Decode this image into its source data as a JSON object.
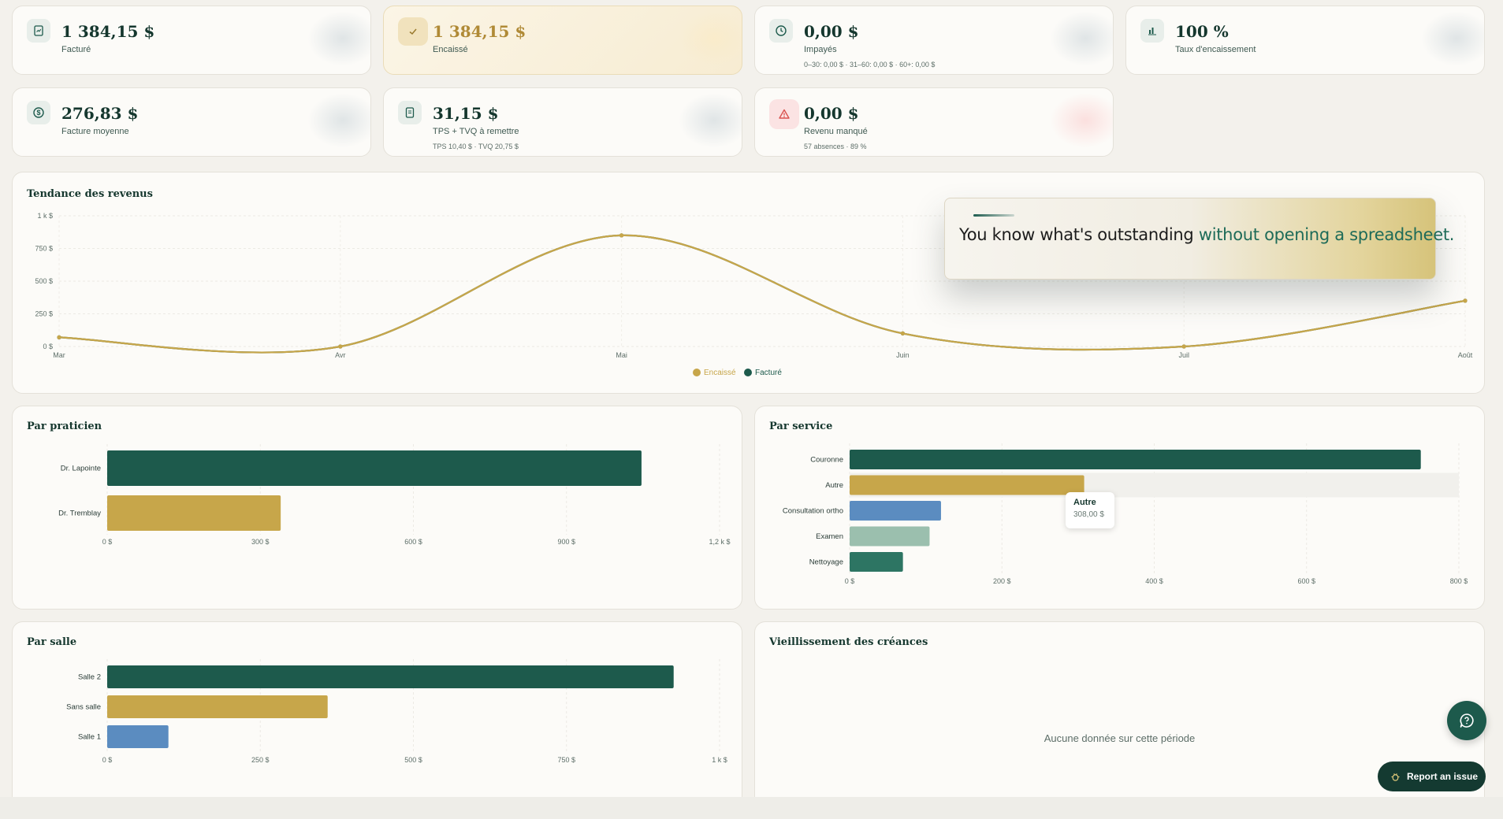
{
  "kpis": [
    {
      "value": "1 384,15 $",
      "label": "Facturé",
      "sub": "",
      "icon": "invoice-icon"
    },
    {
      "value": "1 384,15 $",
      "label": "Encaissé",
      "sub": "",
      "icon": "check-icon"
    },
    {
      "value": "0,00 $",
      "label": "Impayés",
      "sub": "0–30: 0,00 $ · 31–60: 0,00 $ · 60+: 0,00 $",
      "icon": "clock-icon"
    },
    {
      "value": "100 %",
      "label": "Taux d'encaissement",
      "sub": "",
      "icon": "bar-chart-icon"
    },
    {
      "value": "276,83 $",
      "label": "Facture moyenne",
      "sub": "",
      "icon": "dollar-icon"
    },
    {
      "value": "31,15 $",
      "label": "TPS + TVQ à remettre",
      "sub": "TPS 10,40 $ · TVQ 20,75 $",
      "icon": "receipt-icon"
    },
    {
      "value": "0,00 $",
      "label": "Revenu manqué",
      "sub": "57 absences · 89 %",
      "icon": "alert-icon"
    }
  ],
  "colors": {
    "gold": "#c7a64a",
    "green": "#1d5a4c",
    "blue": "#5b8cc0",
    "sage": "#9bbfae",
    "teal": "#2d7563"
  },
  "trend": {
    "title": "Tendance des revenus",
    "legend": [
      "Encaissé",
      "Facturé"
    ],
    "callout_plain": "You know what's outstanding ",
    "callout_highlight": "without opening a spreadsheet."
  },
  "practitioner": {
    "title": "Par praticien"
  },
  "service": {
    "title": "Par service",
    "tooltip_label": "Autre",
    "tooltip_value": "308,00 $"
  },
  "room": {
    "title": "Par salle"
  },
  "aging": {
    "title": "Vieillissement des créances",
    "empty": "Aucune donnée sur cette période"
  },
  "actions": {
    "report": "Report an issue"
  },
  "chart_data": [
    {
      "type": "line",
      "title": "Tendance des revenus",
      "categories": [
        "Mar",
        "Avr",
        "Mai",
        "Juin",
        "Juil",
        "Août"
      ],
      "y_ticks": [
        "0 $",
        "250 $",
        "500 $",
        "750 $",
        "1 k $"
      ],
      "ylim": [
        0,
        1000
      ],
      "series": [
        {
          "name": "Encaissé",
          "values": [
            70,
            0,
            850,
            100,
            0,
            350
          ]
        },
        {
          "name": "Facturé",
          "values": [
            70,
            0,
            850,
            100,
            0,
            350
          ]
        }
      ],
      "legend_position": "bottom-center"
    },
    {
      "type": "bar",
      "orientation": "horizontal",
      "title": "Par praticien",
      "categories": [
        "Dr. Lapointe",
        "Dr. Tremblay"
      ],
      "values": [
        1047,
        340
      ],
      "xlim": [
        0,
        1200
      ],
      "x_ticks": [
        "0 $",
        "300 $",
        "600 $",
        "900 $",
        "1,2 k $"
      ]
    },
    {
      "type": "bar",
      "orientation": "horizontal",
      "title": "Par service",
      "categories": [
        "Couronne",
        "Autre",
        "Consultation ortho",
        "Examen",
        "Nettoyage"
      ],
      "values": [
        750,
        308,
        120,
        105,
        70
      ],
      "xlim": [
        0,
        800
      ],
      "x_ticks": [
        "0 $",
        "200 $",
        "400 $",
        "600 $",
        "800 $"
      ]
    },
    {
      "type": "bar",
      "orientation": "horizontal",
      "title": "Par salle",
      "categories": [
        "Salle 2",
        "Sans salle",
        "Salle 1"
      ],
      "values": [
        925,
        360,
        100
      ],
      "xlim": [
        0,
        1000
      ],
      "x_ticks": [
        "0 $",
        "250 $",
        "500 $",
        "750 $",
        "1 k $"
      ]
    }
  ]
}
